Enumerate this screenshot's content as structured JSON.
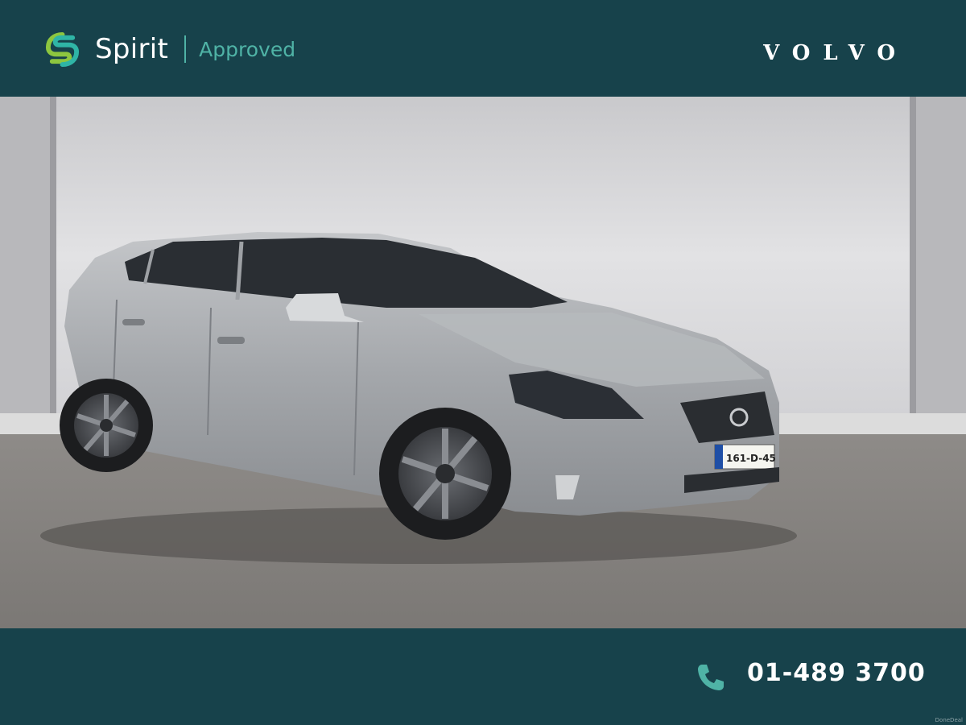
{
  "header": {
    "brand_name": "Spirit",
    "brand_sub": "Approved",
    "make_logo_text": "VOLVO"
  },
  "photo": {
    "plate": "161-D-45",
    "subject": "car-photo"
  },
  "footer": {
    "phone": "01-489 3700",
    "phone_icon": "phone-icon"
  },
  "watermark": "DoneDeal",
  "colors": {
    "bar": "#17424b",
    "accent": "#4fb3a6",
    "car": "#a9acb1"
  }
}
